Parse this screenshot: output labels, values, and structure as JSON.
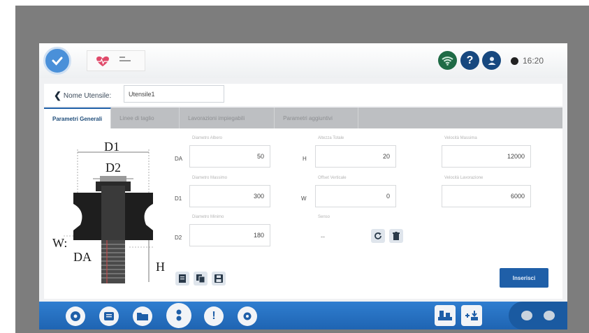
{
  "header": {
    "time": "16:20"
  },
  "toolbar": {
    "back_label": "Nome Utensile:",
    "name_value": "Utensile1"
  },
  "tabs": [
    {
      "label": "Parametri Generali"
    },
    {
      "label": "Linee di taglio"
    },
    {
      "label": "Lavorazioni impiegabili"
    },
    {
      "label": "Parametri aggiuntivi"
    }
  ],
  "diagram": {
    "labels": {
      "d1": "D1",
      "d2": "D2",
      "w": "W:",
      "da": "DA",
      "h": "H"
    }
  },
  "form": {
    "da": {
      "label": "DA",
      "caption": "Diametro Albero",
      "value": "50"
    },
    "d1": {
      "label": "D1",
      "caption": "Diametro Massimo",
      "value": "300"
    },
    "d2": {
      "label": "D2",
      "caption": "Diametro Minimo",
      "value": "180"
    },
    "h": {
      "label": "H",
      "caption": "Altezza Totale",
      "value": "20"
    },
    "w": {
      "label": "W",
      "caption": "Offset Verticale",
      "value": "0"
    },
    "rot": {
      "caption": "Senso",
      "value": "--"
    },
    "vmax": {
      "caption": "Velocità Massima",
      "value": "12000"
    },
    "vdef": {
      "caption": "Velocità Lavorazione",
      "value": "6000"
    }
  },
  "actions": {
    "insert_label": "Inserisci"
  },
  "colors": {
    "primary": "#1f5fa8",
    "topbar_green": "#1f6b46",
    "dark_blue": "#17487f"
  }
}
